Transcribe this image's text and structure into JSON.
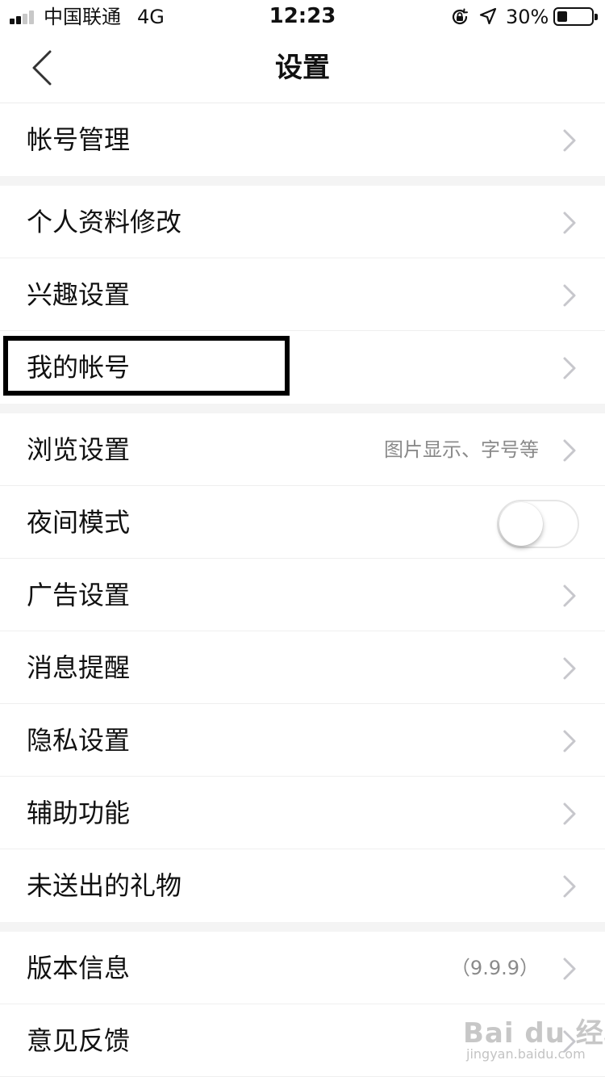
{
  "status_bar": {
    "carrier": "中国联通",
    "network": "4G",
    "time": "12:23",
    "battery_percent": "30%",
    "battery_level": 0.3
  },
  "nav": {
    "title": "设置",
    "back_icon": "chevron-left-icon"
  },
  "groups": [
    {
      "items": [
        {
          "label": "帐号管理"
        }
      ]
    },
    {
      "items": [
        {
          "label": "个人资料修改"
        },
        {
          "label": "兴趣设置"
        },
        {
          "label": "我的帐号"
        }
      ]
    },
    {
      "items": [
        {
          "label": "浏览设置",
          "detail": "图片显示、字号等"
        },
        {
          "label": "夜间模式",
          "toggle": false
        },
        {
          "label": "广告设置"
        },
        {
          "label": "消息提醒"
        },
        {
          "label": "隐私设置"
        },
        {
          "label": "辅助功能"
        },
        {
          "label": "未送出的礼物"
        }
      ]
    },
    {
      "items": [
        {
          "label": "版本信息",
          "detail": "（9.9.9）"
        },
        {
          "label": "意见反馈"
        }
      ]
    }
  ],
  "watermark": {
    "main": "Bai du 经验",
    "sub": "jingyan.baidu.com"
  },
  "colors": {
    "separator": "#f4f4f4",
    "detail_text": "#8a8a8a",
    "chevron": "#c7c7cc"
  }
}
